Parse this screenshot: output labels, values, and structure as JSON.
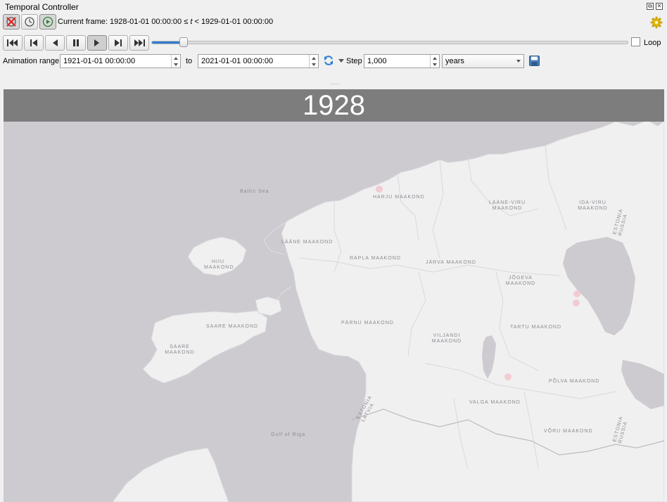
{
  "window": {
    "title": "Temporal Controller"
  },
  "frame": {
    "label": "Current frame:",
    "start": "1928-01-01 00:00:00",
    "rel1": "≤",
    "var": "t",
    "rel2": "<",
    "end": "1929-01-01 00:00:00"
  },
  "playback": {
    "progress": 0.06,
    "loop_label": "Loop",
    "loop_checked": false
  },
  "range": {
    "label": "Animation range",
    "from": "1921-01-01 00:00:00",
    "to_label": "to",
    "to": "2021-01-01 00:00:00",
    "step_label": "Step",
    "step": "1,000",
    "unit": "years"
  },
  "splitter": "......",
  "overlay": {
    "year": "1928"
  },
  "map": {
    "colors": {
      "land": "#f0f0f0",
      "water": "#cdcbd0",
      "points": "#f3c4cc",
      "banner": "#767676"
    },
    "labels": [
      {
        "text": "Baltic Sea"
      },
      {
        "text": "HARJU MAAKOND"
      },
      {
        "text": "LÄÄNE-VIRU MAAKOND"
      },
      {
        "text": "IDA-VIRU MAAKOND"
      },
      {
        "text": "LÄÄNE MAAKOND"
      },
      {
        "text": "RAPLA MAAKOND"
      },
      {
        "text": "JÄRVA MAAKOND"
      },
      {
        "text": "HIIU MAAKOND"
      },
      {
        "text": "JÕGEVA MAAKOND"
      },
      {
        "text": "SAARE MAAKOND"
      },
      {
        "text": "PÄRNU MAAKOND"
      },
      {
        "text": "TARTU MAAKOND"
      },
      {
        "text": "SAARE MAAKOND"
      },
      {
        "text": "VILJANDI MAAKOND"
      },
      {
        "text": "PÕLVA MAAKOND"
      },
      {
        "text": "VALGA MAAKOND"
      },
      {
        "text": "Gulf of Riga"
      },
      {
        "text": "VÕRU MAAKOND"
      },
      {
        "text": "ESTONIA LATVIA"
      },
      {
        "text": "ESTONIA RUSSIA"
      },
      {
        "text": "ESTONIA RUSSIA"
      }
    ]
  }
}
